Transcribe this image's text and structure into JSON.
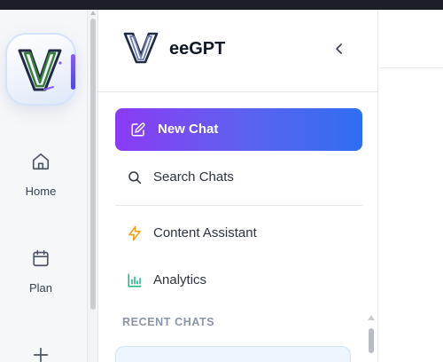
{
  "brand": {
    "name": "eeGPT",
    "logo_icon": "v-logo-icon"
  },
  "rail": {
    "items": [
      {
        "label": "Home",
        "icon": "home-icon"
      },
      {
        "label": "Plan",
        "icon": "calendar-icon"
      },
      {
        "label": "",
        "icon": "plus-icon"
      }
    ]
  },
  "sidebar": {
    "collapse_icon": "chevron-left-icon",
    "new_chat": {
      "label": "New Chat",
      "icon": "edit-icon"
    },
    "search": {
      "label": "Search Chats",
      "icon": "search-icon"
    },
    "items": [
      {
        "label": "Content Assistant",
        "icon": "lightning-icon"
      },
      {
        "label": "Analytics",
        "icon": "bar-chart-icon"
      }
    ],
    "recent_title": "RECENT CHATS"
  },
  "colors": {
    "accent_start": "#8b3bf2",
    "accent_end": "#2f6ef0",
    "lightning": "#f59e0b",
    "analytics": "#10b981"
  }
}
